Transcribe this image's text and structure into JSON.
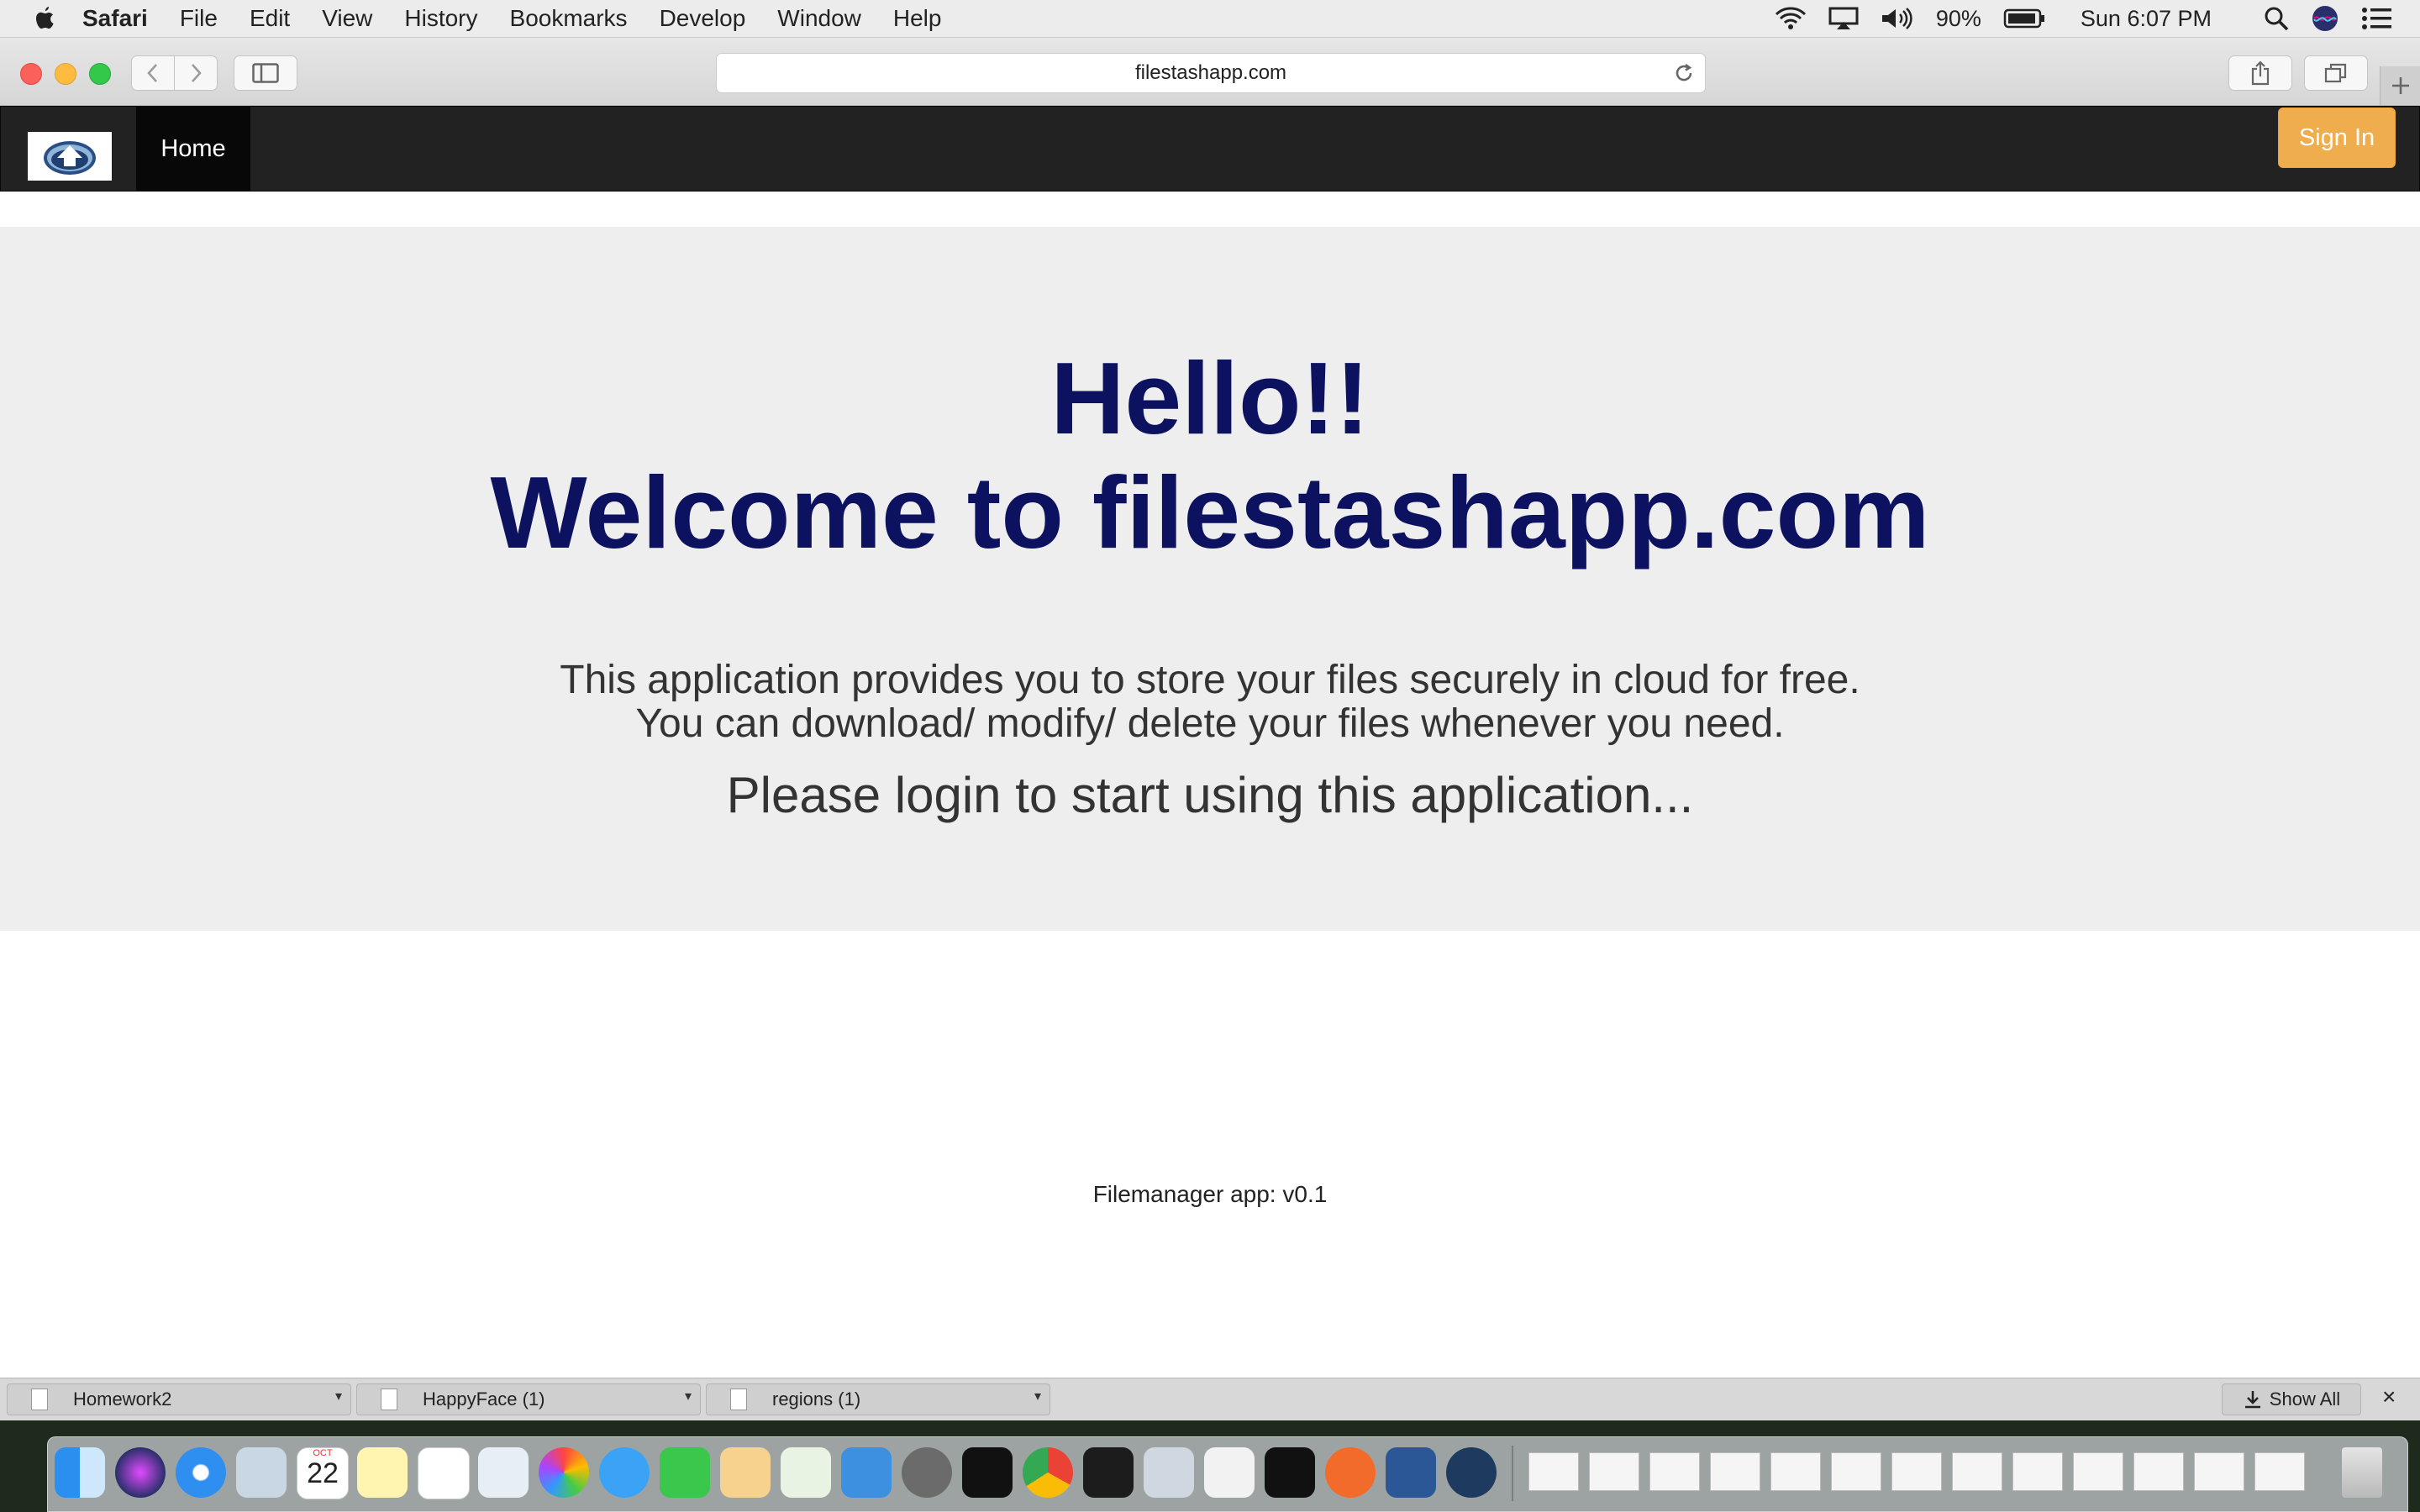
{
  "menubar": {
    "app": "Safari",
    "items": [
      "File",
      "Edit",
      "View",
      "History",
      "Bookmarks",
      "Develop",
      "Window",
      "Help"
    ],
    "battery": "90%",
    "clock": "Sun 6:07 PM"
  },
  "browser": {
    "url": "filestashapp.com"
  },
  "site": {
    "nav_home": "Home",
    "sign_in": "Sign In",
    "heading_line1": "Hello!!",
    "heading_line2": "Welcome to filestashapp.com",
    "desc_line1": "This application provides you to store your files securely in cloud for free.",
    "desc_line2": "You can download/ modify/ delete your files whenever you need.",
    "cta": "Please login to start using this application...",
    "footer": "Filemanager app: v0.1"
  },
  "downloads": {
    "items": [
      "Homework2",
      "HappyFace (1)",
      "regions (1)"
    ],
    "show_all": "Show All",
    "close": "×"
  },
  "dock": {
    "calendar_month": "OCT",
    "calendar_day": "22"
  },
  "colors": {
    "navbar": "#222222",
    "sign_in": "#f0ad4e",
    "heading": "#0d1260",
    "jumbotron": "#eeeeee"
  }
}
